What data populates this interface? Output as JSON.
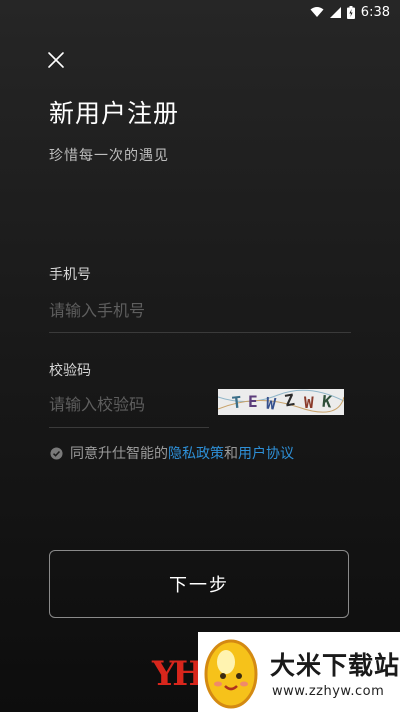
{
  "status_bar": {
    "time": "6:38"
  },
  "header": {
    "title": "新用户注册",
    "subtitle": "珍惜每一次的遇见"
  },
  "phone": {
    "label": "手机号",
    "placeholder": "请输入手机号"
  },
  "code": {
    "label": "校验码",
    "placeholder": "请输入校验码",
    "captcha_text": "TEWZWK"
  },
  "agreement": {
    "prefix": "同意升仕智能的",
    "privacy_link": "隐私政策",
    "and": "和",
    "user_link": "用户协议"
  },
  "next_button": {
    "label": "下一步"
  },
  "watermark": {
    "brand": "大米下载站",
    "url": "www.zzhyw.com"
  },
  "colors": {
    "link": "#2e8fd6",
    "background": "#1b1b1b"
  }
}
